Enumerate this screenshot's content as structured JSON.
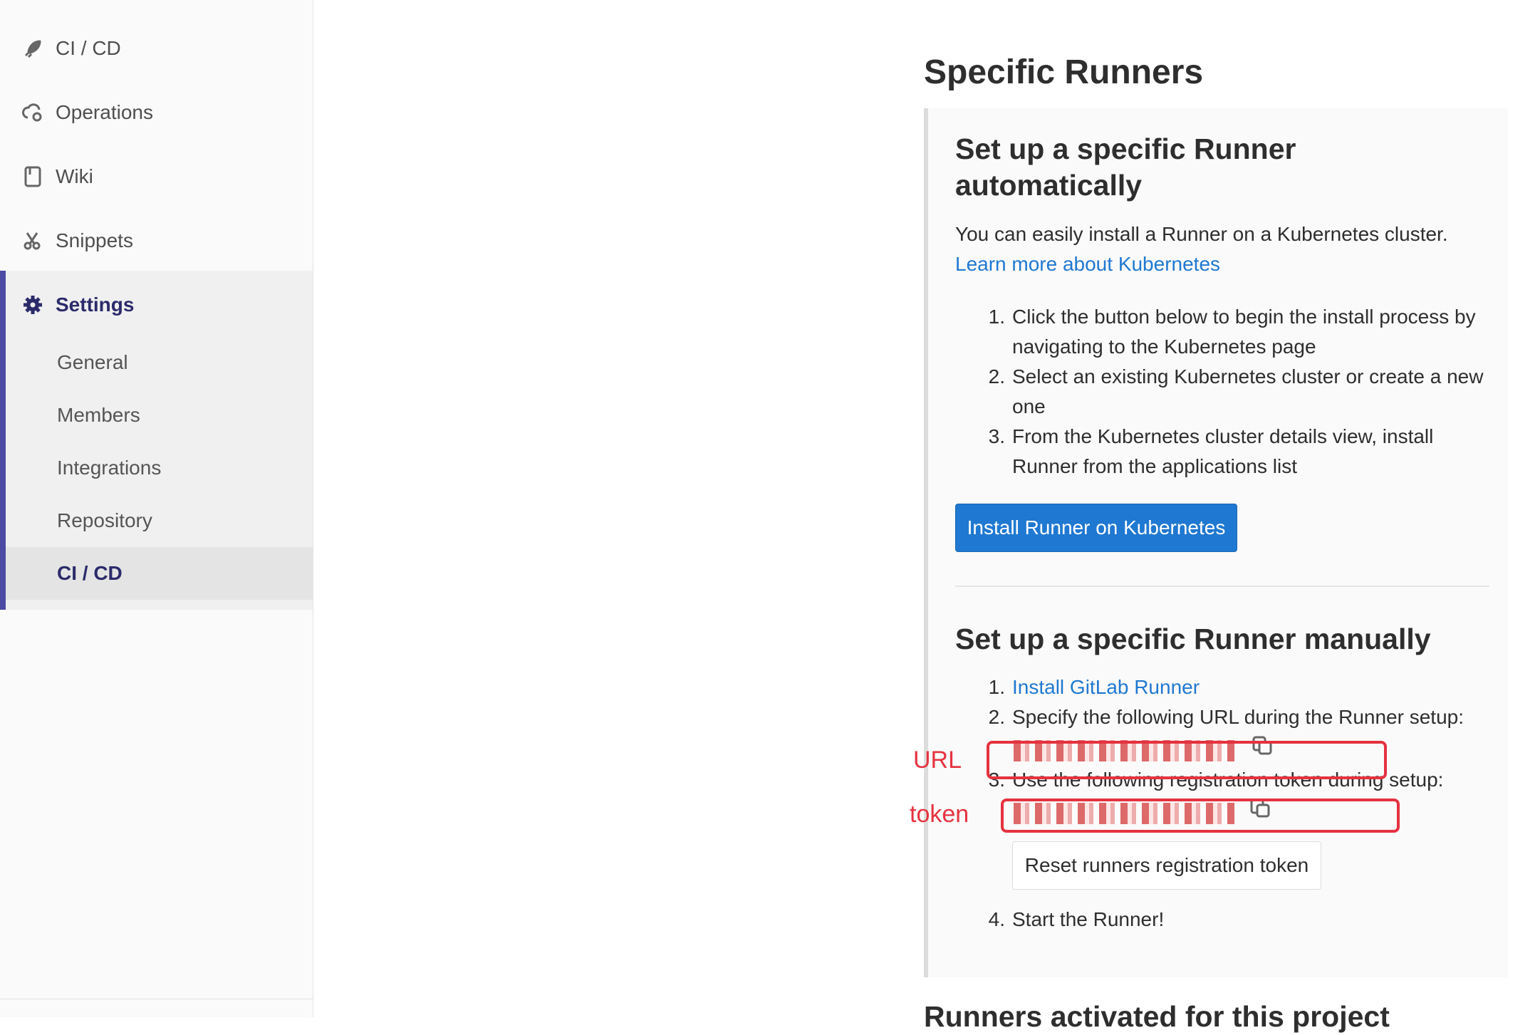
{
  "sidebar": {
    "items": [
      {
        "label": "CI / CD",
        "icon": "rocket-icon"
      },
      {
        "label": "Operations",
        "icon": "cloud-gear-icon"
      },
      {
        "label": "Wiki",
        "icon": "book-icon"
      },
      {
        "label": "Snippets",
        "icon": "scissors-icon"
      },
      {
        "label": "Settings",
        "icon": "gear-icon"
      }
    ],
    "settings_sub": [
      {
        "label": "General"
      },
      {
        "label": "Members"
      },
      {
        "label": "Integrations"
      },
      {
        "label": "Repository"
      },
      {
        "label": "CI / CD"
      }
    ],
    "active_color": "#4b4ba3"
  },
  "main": {
    "title": "Specific Runners",
    "auto": {
      "heading": "Set up a specific Runner automatically",
      "desc": "You can easily install a Runner on a Kubernetes cluster.",
      "learn_link": "Learn more about Kubernetes",
      "steps": [
        {
          "num": "1.",
          "text": "Click the button below to begin the install process by navigating to the Kubernetes page"
        },
        {
          "num": "2.",
          "text": "Select an existing Kubernetes cluster or create a new one"
        },
        {
          "num": "3.",
          "text": "From the Kubernetes cluster details view, install Runner from the applications list"
        }
      ],
      "button": "Install Runner on Kubernetes"
    },
    "manual": {
      "heading": "Set up a specific Runner manually",
      "step1_num": "1.",
      "step1_link": "Install GitLab Runner",
      "step2_num": "2.",
      "step2_text": "Specify the following URL during the Runner setup:",
      "step3_num": "3.",
      "step3_text": "Use the following registration token during setup:",
      "reset_button": "Reset runners registration token",
      "step4_num": "4.",
      "step4_text": "Start the Runner!"
    },
    "next_heading": "Runners activated for this project"
  },
  "annotations": {
    "url_label": "URL",
    "token_label": "token",
    "color": "#e5323f"
  },
  "colors": {
    "link": "#1f78d1",
    "primary": "#1f78d1",
    "text": "#2e2e2e"
  }
}
